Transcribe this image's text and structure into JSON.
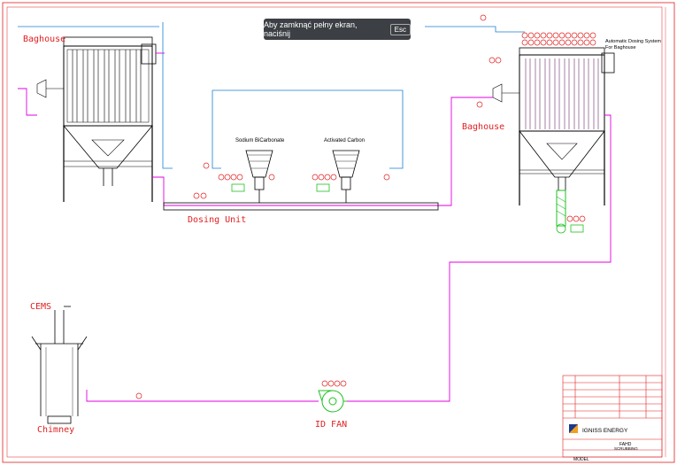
{
  "labels": {
    "baghouse_left": "Baghouse",
    "baghouse_right": "Baghouse",
    "dosing_unit": "Dosing Unit",
    "sodium_bicarbonate": "Sodium BiCarbonate",
    "activated_carbon": "Activated Carbon",
    "automatic_dosing": "Automatic Dosing System",
    "automatic_dosing_2": "For Baghouse",
    "cems": "CEMS",
    "chimney": "Chimney",
    "id_fan": "ID FAN"
  },
  "toast": {
    "message": "Aby zamknąć pełny ekran, naciśnij",
    "key": "Esc"
  },
  "title_block": {
    "company": "IGNISS ENERGY",
    "drawing_title": "FAHD",
    "drawing_subtitle": "SCRUBBING",
    "model": "MODEL"
  },
  "colors": {
    "flue_gas_line": "#e000e0",
    "air_line": "#1a7fd0",
    "instrument": "#e02020",
    "equipment": "#000000",
    "conveyor": "#20c020",
    "motor": "#20c020"
  }
}
